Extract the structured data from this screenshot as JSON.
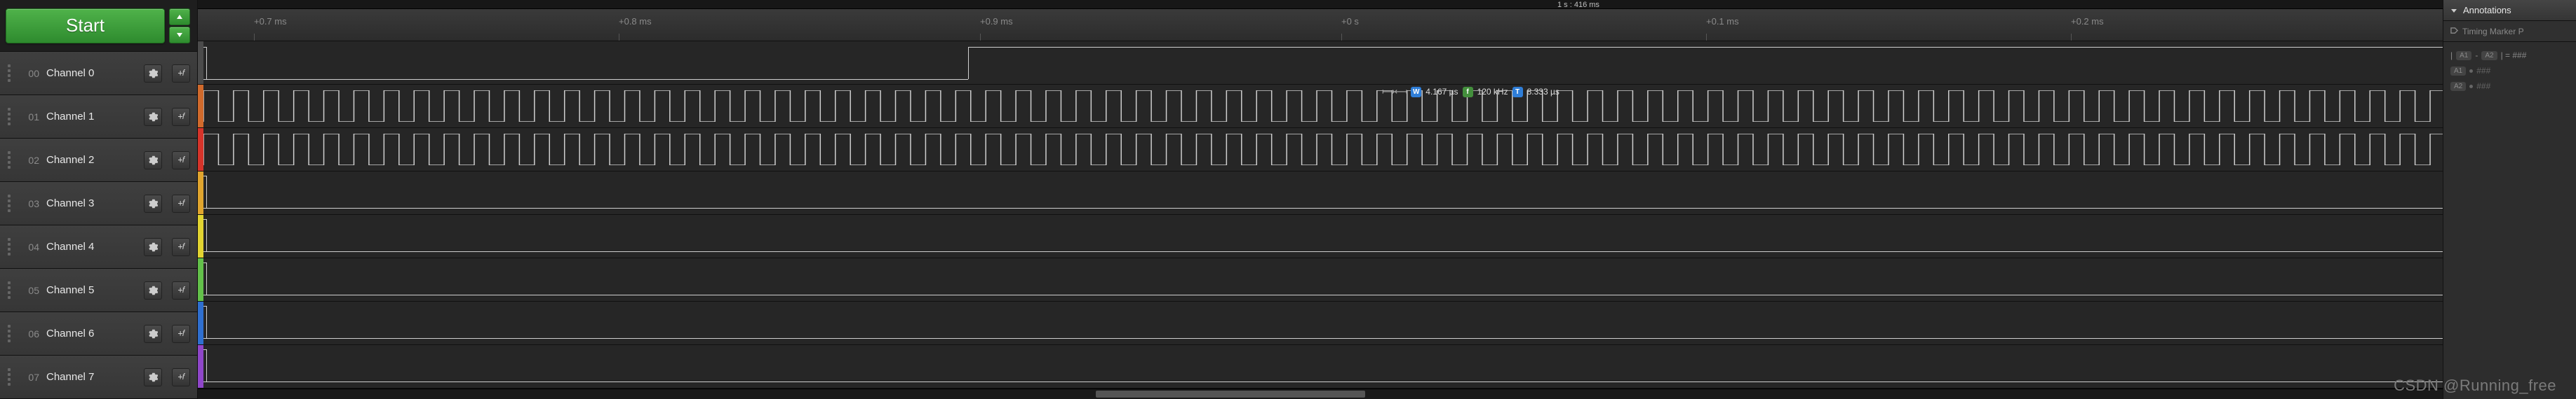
{
  "controls": {
    "start_label": "Start"
  },
  "timeline": {
    "cursor": "1 s : 416 ms",
    "ticks": [
      {
        "label": "+0.7 ms",
        "pos": 80
      },
      {
        "label": "+0.8 ms",
        "pos": 600
      },
      {
        "label": "+0.9 ms",
        "pos": 1115
      },
      {
        "label": "+0 s",
        "pos": 1630
      },
      {
        "label": "+0.1 ms",
        "pos": 2150
      },
      {
        "label": "+0.2 ms",
        "pos": 2670
      }
    ]
  },
  "channels": [
    {
      "idx": "00",
      "name": "Channel 0",
      "color": "strip-0"
    },
    {
      "idx": "01",
      "name": "Channel 1",
      "color": "strip-1"
    },
    {
      "idx": "02",
      "name": "Channel 2",
      "color": "strip-2"
    },
    {
      "idx": "03",
      "name": "Channel 3",
      "color": "strip-3"
    },
    {
      "idx": "04",
      "name": "Channel 4",
      "color": "strip-4"
    },
    {
      "idx": "05",
      "name": "Channel 5",
      "color": "strip-5"
    },
    {
      "idx": "06",
      "name": "Channel 6",
      "color": "strip-6"
    },
    {
      "idx": "07",
      "name": "Channel 7",
      "color": "strip-7"
    }
  ],
  "measurement": {
    "width": "4.167 µs",
    "freq": "120 kHz",
    "period": "8.333 µs"
  },
  "annotations": {
    "header": "Annotations",
    "sub": "Timing Marker P",
    "line1_a": "A1",
    "line1_b": "A2",
    "line1_sep": " - ",
    "line1_eq": " | = ###",
    "rowA1": "A1",
    "rowA2": "A2",
    "rowNone": "###"
  },
  "watermark": "CSDN @Running_free"
}
